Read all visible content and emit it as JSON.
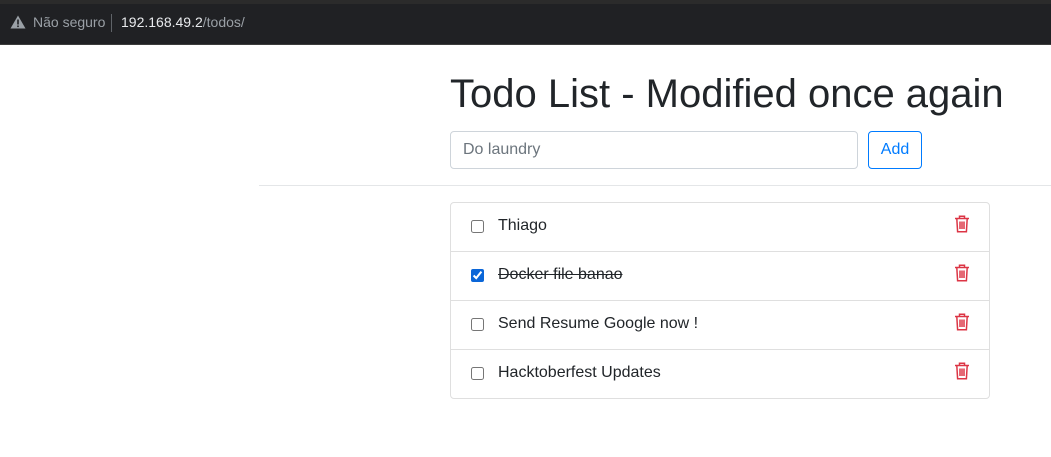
{
  "browser": {
    "security_label": "Não seguro",
    "url_host": "192.168.49.2",
    "url_path": "/todos/"
  },
  "page": {
    "title": "Todo List - Modified once again"
  },
  "form": {
    "placeholder": "Do laundry",
    "add_label": "Add"
  },
  "todos": [
    {
      "text": "Thiago",
      "done": false
    },
    {
      "text": "Docker file banao",
      "done": true
    },
    {
      "text": "Send Resume Google now !",
      "done": false
    },
    {
      "text": "Hacktoberfest Updates",
      "done": false
    }
  ],
  "colors": {
    "accent": "#007bff",
    "delete": "#dc3545",
    "checkbox_checked": "#0a66d8"
  },
  "icons": {
    "security": "warning-triangle-icon",
    "delete": "trash-icon"
  }
}
